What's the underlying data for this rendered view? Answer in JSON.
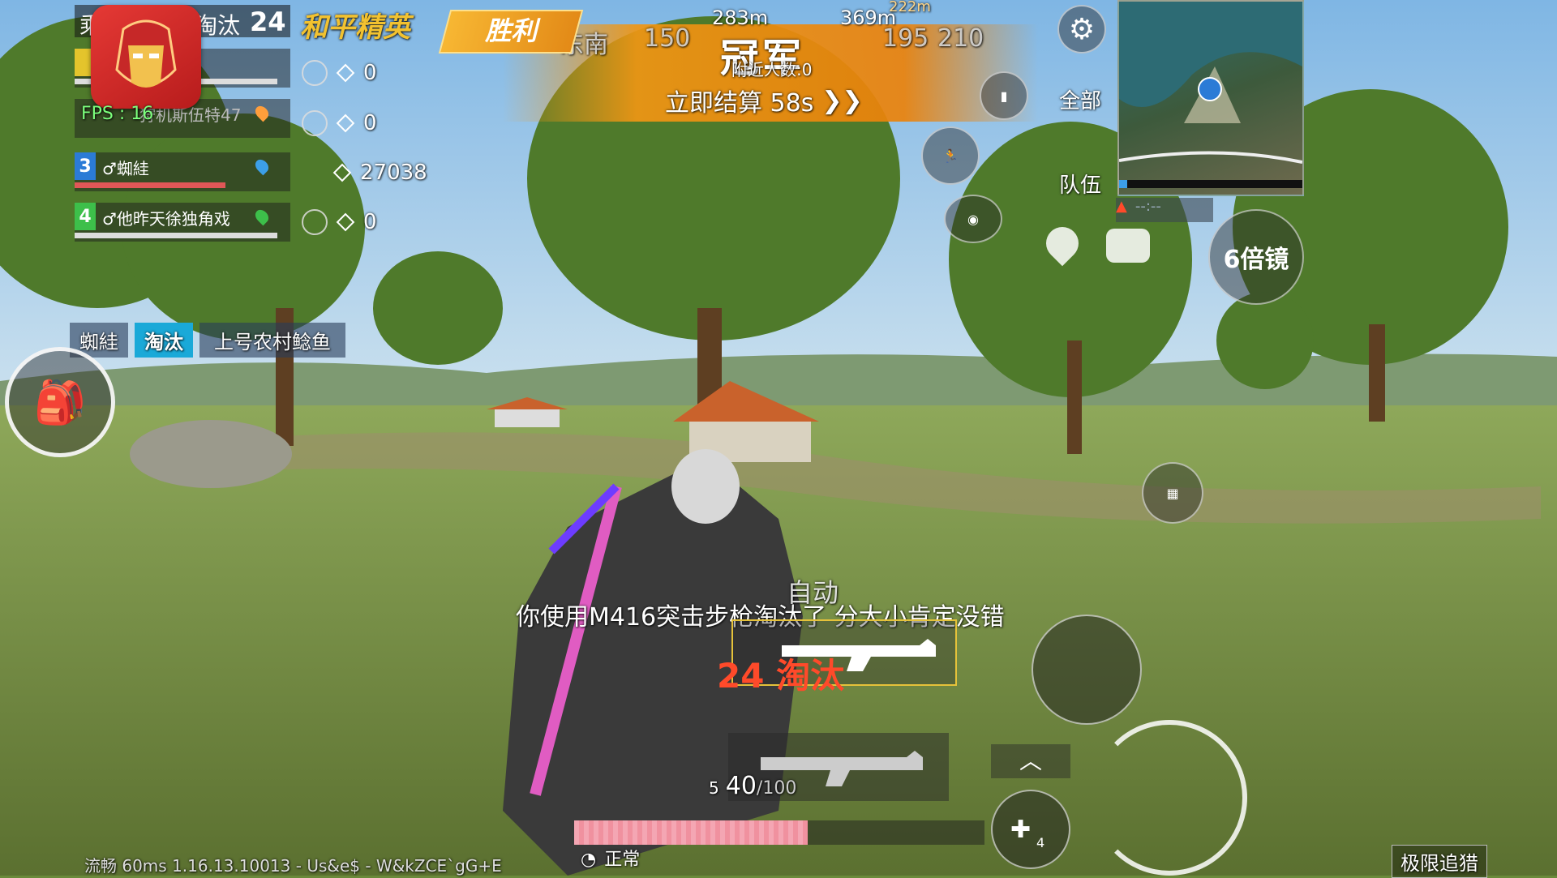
{
  "team_panel": {
    "header_left": "乘",
    "header_mid": "淘汰",
    "header_kills": "24",
    "fps": "FPS : 16",
    "members": [
      {
        "num": "3",
        "name": "♂蜘絓",
        "color": "#2b7bd6"
      },
      {
        "num": "4",
        "name": "♂他昨天徐独角戏",
        "color": "#3dbf4a"
      }
    ],
    "partial_member": "狩机斯伍特47",
    "stats": [
      "0",
      "0",
      "27038",
      "0"
    ]
  },
  "brand": "和平精英",
  "victory_label": "胜利",
  "compass": {
    "labels": [
      "东南",
      "150",
      "195",
      "210"
    ],
    "dist_left": "283m",
    "dist_right": "369m",
    "dist_far": "222m"
  },
  "banner": {
    "title": "冠军",
    "nearby": "附近人数:0",
    "settle": "立即结算 58s",
    "settle_arrow": "❯❯"
  },
  "right_panel": {
    "speaker_label": "全部",
    "team_label": "队伍",
    "scope_label": "6倍镜",
    "warn_text": "--:--"
  },
  "kill_feed": {
    "killer": "蜘絓",
    "tag": "淘汰",
    "victim": "上号农村鲶鱼"
  },
  "combat": {
    "fire_mode": "自动",
    "kill_message": "你使用M416突击步枪淘汰了 分大小肯定没错",
    "kill_count": "24 淘汰",
    "ammo_slot": "5",
    "ammo_current": "40",
    "ammo_max": "/100",
    "health_fraction": 0.57,
    "status": "正常",
    "grenade_count": "4"
  },
  "bottom": {
    "info": "流畅  60ms  1.16.13.10013 - Us&e$ - W&kZCE`gG+E",
    "mode": "极限追猎"
  },
  "colors": {
    "accent": "#f0961a",
    "health": "#f4a6b3",
    "kill_red": "#ff4a2a"
  }
}
